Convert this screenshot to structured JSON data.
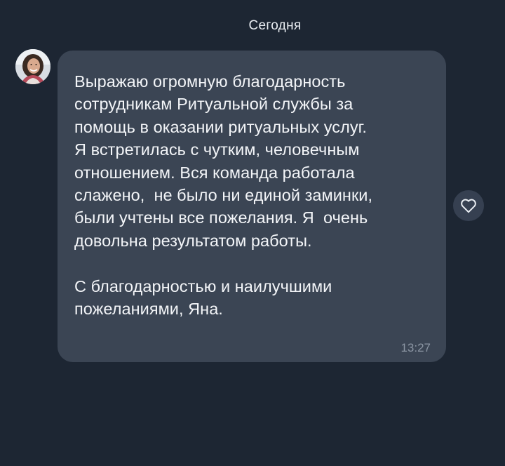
{
  "date_separator": "Сегодня",
  "message": {
    "text": "Выражаю огромную благодарность\nсотрудникам Ритуальной службы за\nпомощь в оказании ритуальных услуг.\nЯ встретилась с чутким, человечным\nотношением. Вся команда работала\nслажено,  не было ни единой заминки,\nбыли учтены все пожелания. Я  очень\nдовольна результатом работы.\n\nС благодарностью и наилучшими\nпожеланиями, Яна.",
    "time": "13:27"
  },
  "icons": {
    "avatar": "user-avatar",
    "like": "heart-icon"
  },
  "colors": {
    "background": "#1d2633",
    "bubble": "#3b4554",
    "text": "#f3f5f8",
    "time": "#8b95a3",
    "like_button": "#364051"
  }
}
